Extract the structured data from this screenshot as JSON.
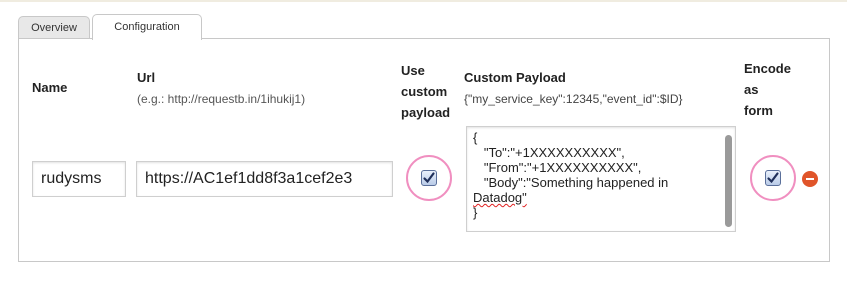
{
  "tabs": [
    {
      "label": "Overview",
      "active": false
    },
    {
      "label": "Configuration",
      "active": true
    }
  ],
  "columns": {
    "name": "Name",
    "url": "Url",
    "url_hint": "(e.g.: http://requestb.in/1ihukij1)",
    "use_custom_payload": [
      "Use",
      "custom",
      "payload"
    ],
    "custom_payload": "Custom Payload",
    "custom_payload_hint": "{\"my_service_key\":12345,\"event_id\":$ID}",
    "encode_as_form": [
      "Encode",
      "as",
      "form"
    ]
  },
  "row": {
    "name_value": "rudysms",
    "url_value": "https://AC1ef1dd8f3a1cef2e3",
    "use_custom_payload": true,
    "payload_lines": [
      "{",
      "   \"To\":\"+1XXXXXXXXXX\",",
      "   \"From\":\"+1XXXXXXXXXX\",",
      "   \"Body\":\"Something happened in",
      "Datadog\"",
      "}"
    ],
    "encode_as_form": true,
    "remove_icon": "minus-circle-icon"
  },
  "colors": {
    "highlight_ring": "#f08fc0",
    "remove_button": "#e0552a"
  }
}
